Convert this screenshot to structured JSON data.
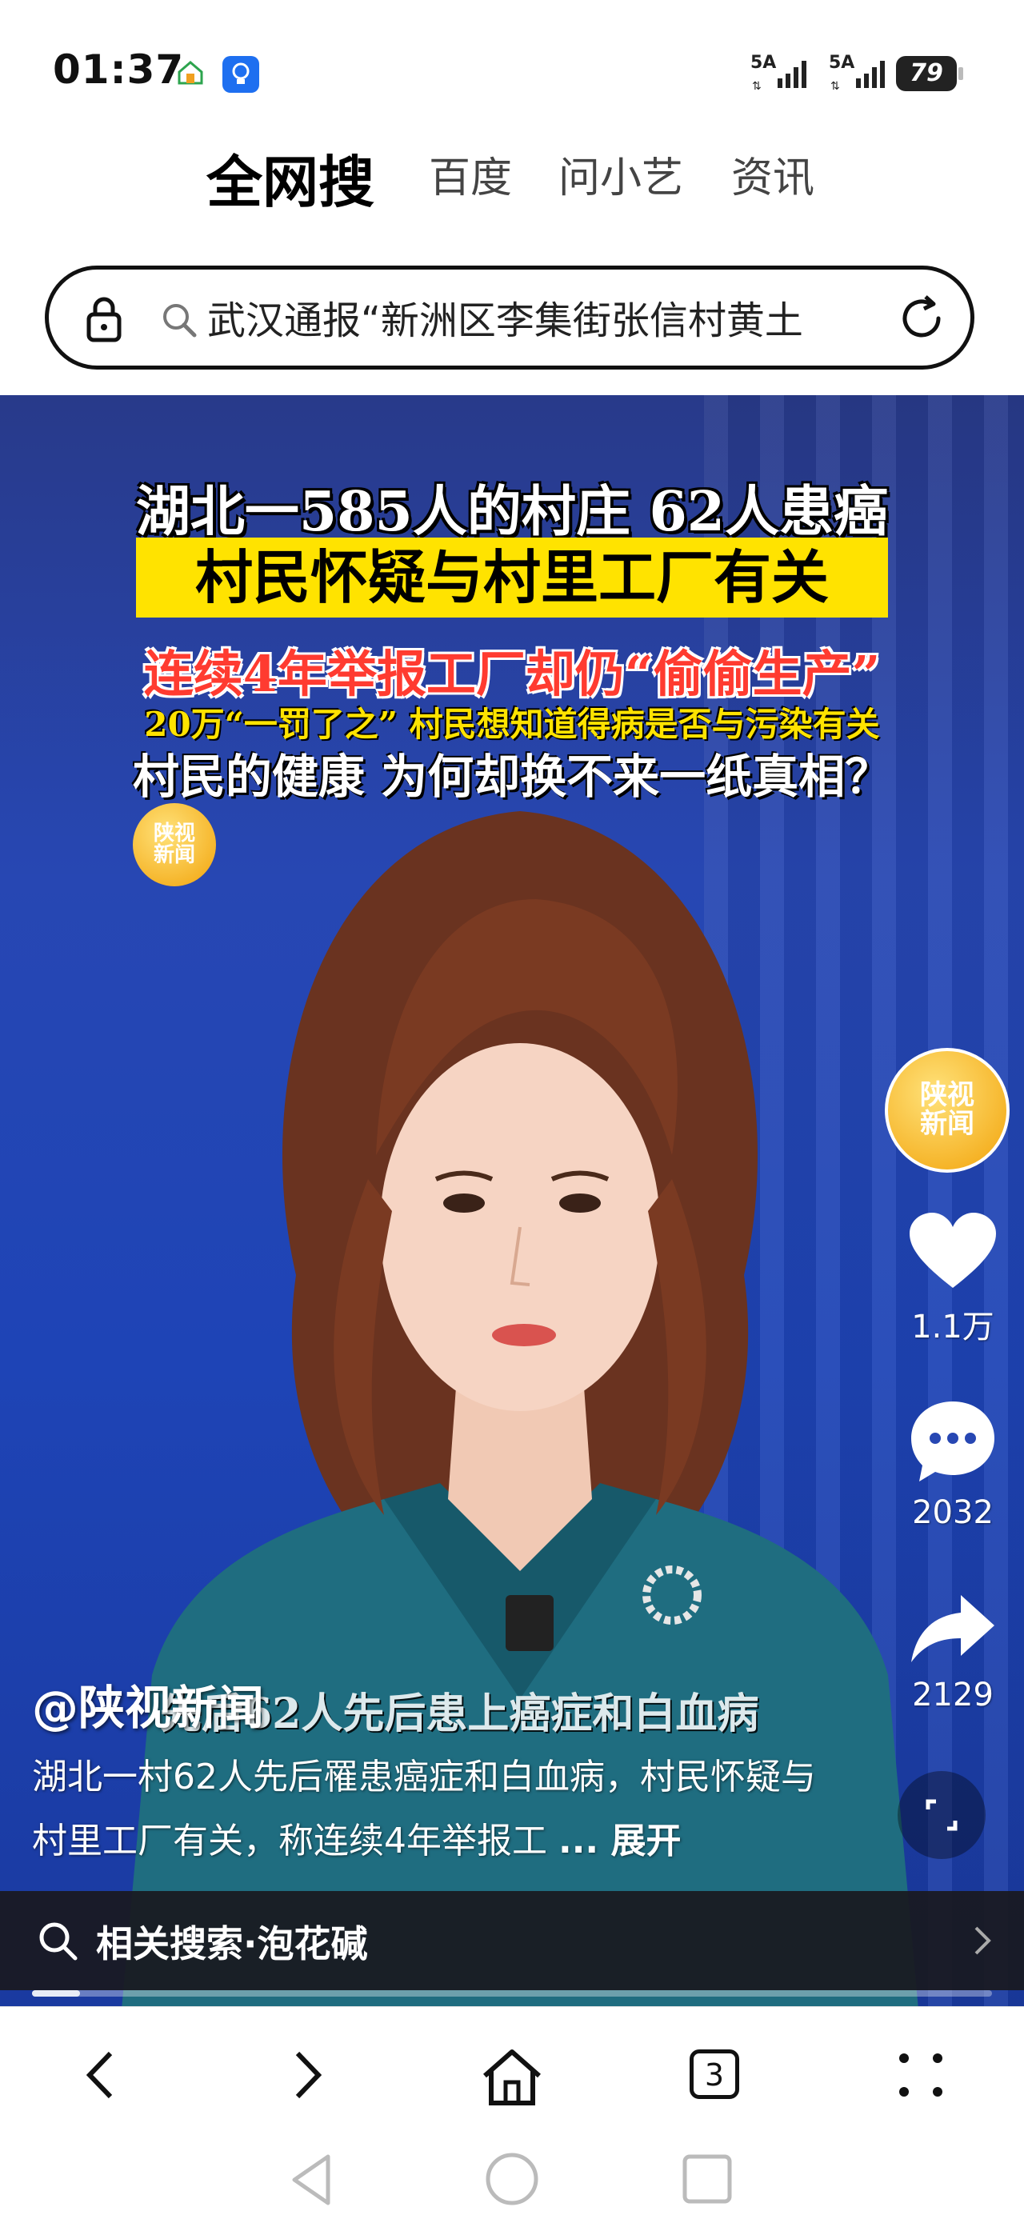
{
  "status_bar": {
    "time": "01:37",
    "signal1_label": "5A",
    "signal2_label": "5A",
    "battery": "79"
  },
  "tabs": [
    {
      "label": "全网搜",
      "active": true
    },
    {
      "label": "百度",
      "active": false
    },
    {
      "label": "问小艺",
      "active": false
    },
    {
      "label": "资讯",
      "active": false
    }
  ],
  "search": {
    "query": "武汉通报“新洲区李集街张信村黄土"
  },
  "video": {
    "headline_line1": "湖北一585人的村庄 62人患癌",
    "headline_line2": "村民怀疑与村里工厂有关",
    "headline_line3": "连续4年举报工厂却仍“偷偷生产”",
    "headline_line4": "20万“一罚了之” 村民想知道得病是否与污染有关",
    "headline_line5": "村民的健康 为何却换不来一纸真相？",
    "logo_text": "陕视\n新闻",
    "subtitle": "先后62人先后患上癌症和白血病",
    "author": "@陕视新闻",
    "description": "湖北一村62人先后罹患癌症和白血病，村民怀疑与村里工厂有关，称连续4年举报工",
    "description_more": "... 展开",
    "likes": "1.1万",
    "comments": "2032",
    "shares": "2129",
    "related_search": "相关搜索·泡花碱",
    "progress": 0.05
  },
  "bottom_nav": {
    "tab_count": "3"
  },
  "colors": {
    "headline_highlight": "#ffe300",
    "headline_red": "#ff3b30",
    "video_bg": "#2747b3"
  }
}
